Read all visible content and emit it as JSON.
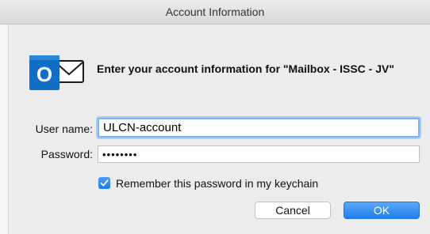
{
  "window": {
    "title": "Account Information"
  },
  "dialog": {
    "message": "Enter your account information for \"Mailbox - ISSC - JV\"",
    "app_icon": "outlook-icon"
  },
  "form": {
    "username_label": "User name:",
    "username_value": "ULCN-account",
    "password_label": "Password:",
    "password_value": "••••••••",
    "remember_label": "Remember this password in my keychain",
    "remember_checked": true
  },
  "buttons": {
    "cancel_label": "Cancel",
    "ok_label": "OK"
  },
  "colors": {
    "accent": "#1f7ef0",
    "focus_ring": "#7fb2ef",
    "outlook_blue": "#0f6fc6"
  }
}
